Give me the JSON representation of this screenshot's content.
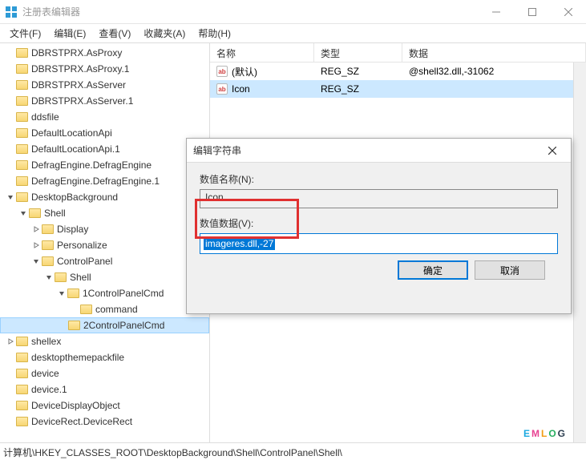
{
  "window": {
    "title": "注册表编辑器"
  },
  "menu": {
    "file": "文件(F)",
    "edit": "编辑(E)",
    "view": "查看(V)",
    "favorites": "收藏夹(A)",
    "help": "帮助(H)"
  },
  "tree": {
    "items": [
      {
        "indent": 0,
        "exp": "",
        "label": "DBRSTPRX.AsProxy"
      },
      {
        "indent": 0,
        "exp": "",
        "label": "DBRSTPRX.AsProxy.1"
      },
      {
        "indent": 0,
        "exp": "",
        "label": "DBRSTPRX.AsServer"
      },
      {
        "indent": 0,
        "exp": "",
        "label": "DBRSTPRX.AsServer.1"
      },
      {
        "indent": 0,
        "exp": "",
        "label": "ddsfile"
      },
      {
        "indent": 0,
        "exp": "",
        "label": "DefaultLocationApi"
      },
      {
        "indent": 0,
        "exp": "",
        "label": "DefaultLocationApi.1"
      },
      {
        "indent": 0,
        "exp": "",
        "label": "DefragEngine.DefragEngine"
      },
      {
        "indent": 0,
        "exp": "",
        "label": "DefragEngine.DefragEngine.1"
      },
      {
        "indent": 0,
        "exp": "open",
        "label": "DesktopBackground"
      },
      {
        "indent": 1,
        "exp": "open",
        "label": "Shell"
      },
      {
        "indent": 2,
        "exp": "closed",
        "label": "Display"
      },
      {
        "indent": 2,
        "exp": "closed",
        "label": "Personalize"
      },
      {
        "indent": 2,
        "exp": "open",
        "label": "ControlPanel"
      },
      {
        "indent": 3,
        "exp": "open",
        "label": "Shell"
      },
      {
        "indent": 4,
        "exp": "open",
        "label": "1ControlPanelCmd"
      },
      {
        "indent": 5,
        "exp": "",
        "label": "command"
      },
      {
        "indent": 4,
        "exp": "",
        "label": "2ControlPanelCmd",
        "selected": true
      },
      {
        "indent": 0,
        "exp": "closed",
        "label": "shellex"
      },
      {
        "indent": 0,
        "exp": "",
        "label": "desktopthemepackfile"
      },
      {
        "indent": 0,
        "exp": "",
        "label": "device"
      },
      {
        "indent": 0,
        "exp": "",
        "label": "device.1"
      },
      {
        "indent": 0,
        "exp": "",
        "label": "DeviceDisplayObject"
      },
      {
        "indent": 0,
        "exp": "",
        "label": "DeviceRect.DeviceRect"
      }
    ]
  },
  "list": {
    "headers": {
      "name": "名称",
      "type": "类型",
      "data": "数据"
    },
    "rows": [
      {
        "name": "(默认)",
        "type": "REG_SZ",
        "data": "@shell32.dll,-31062",
        "selected": false
      },
      {
        "name": "Icon",
        "type": "REG_SZ",
        "data": "",
        "selected": true
      }
    ]
  },
  "dialog": {
    "title": "编辑字符串",
    "name_label": "数值名称(N):",
    "name_value": "Icon",
    "data_label": "数值数据(V):",
    "data_value": "imageres.dll,-27",
    "ok": "确定",
    "cancel": "取消"
  },
  "statusbar": {
    "path": "计算机\\HKEY_CLASSES_ROOT\\DesktopBackground\\Shell\\ControlPanel\\Shell\\"
  },
  "watermark": {
    "e": "E",
    "m": "M",
    "l": "L",
    "o": "O",
    "g": "G"
  }
}
